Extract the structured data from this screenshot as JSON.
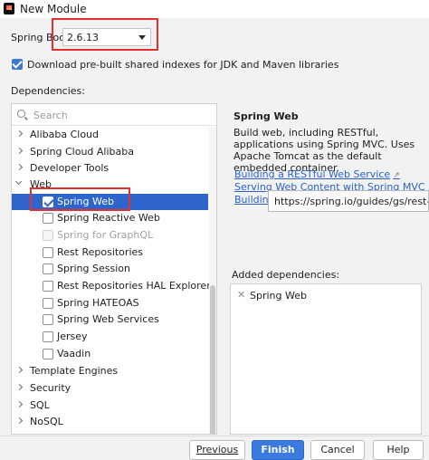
{
  "window": {
    "title": "New Module"
  },
  "spring_boot": {
    "label": "Spring Boot:",
    "selected": "2.6.13"
  },
  "download_indexes": {
    "label": "Download pre-built shared indexes for JDK and Maven libraries",
    "checked": true
  },
  "dependencies": {
    "label": "Dependencies:",
    "search_placeholder": "Search",
    "tree": [
      {
        "label": "Alibaba Cloud",
        "type": "group",
        "expanded": false
      },
      {
        "label": "Spring Cloud Alibaba",
        "type": "group",
        "expanded": false
      },
      {
        "label": "Developer Tools",
        "type": "group",
        "expanded": false
      },
      {
        "label": "Web",
        "type": "group",
        "expanded": true
      },
      {
        "label": "Spring Web",
        "type": "item",
        "checked": true,
        "selected": true
      },
      {
        "label": "Spring Reactive Web",
        "type": "item",
        "checked": false
      },
      {
        "label": "Spring for GraphQL",
        "type": "item",
        "checked": false,
        "disabled": true
      },
      {
        "label": "Rest Repositories",
        "type": "item",
        "checked": false
      },
      {
        "label": "Spring Session",
        "type": "item",
        "checked": false
      },
      {
        "label": "Rest Repositories HAL Explorer",
        "type": "item",
        "checked": false
      },
      {
        "label": "Spring HATEOAS",
        "type": "item",
        "checked": false
      },
      {
        "label": "Spring Web Services",
        "type": "item",
        "checked": false
      },
      {
        "label": "Jersey",
        "type": "item",
        "checked": false
      },
      {
        "label": "Vaadin",
        "type": "item",
        "checked": false
      },
      {
        "label": "Template Engines",
        "type": "group",
        "expanded": false
      },
      {
        "label": "Security",
        "type": "group",
        "expanded": false
      },
      {
        "label": "SQL",
        "type": "group",
        "expanded": false
      },
      {
        "label": "NoSQL",
        "type": "group",
        "expanded": false
      }
    ]
  },
  "details": {
    "title": "Spring Web",
    "description": "Build web, including RESTful, applications using Spring MVC. Uses Apache Tomcat as the default embedded container.",
    "links": [
      "Building a RESTful Web Service",
      "Serving Web Content with Spring MVC",
      "Building"
    ],
    "tooltip": "https://spring.io/guides/gs/rest-service/"
  },
  "added": {
    "label": "Added dependencies:",
    "items": [
      "Spring Web"
    ]
  },
  "buttons": {
    "previous": "Previous",
    "finish": "Finish",
    "cancel": "Cancel",
    "help": "Help"
  },
  "colors": {
    "accent": "#2f65ca",
    "highlight_box": "#e4312f",
    "link": "#2a62c8"
  }
}
